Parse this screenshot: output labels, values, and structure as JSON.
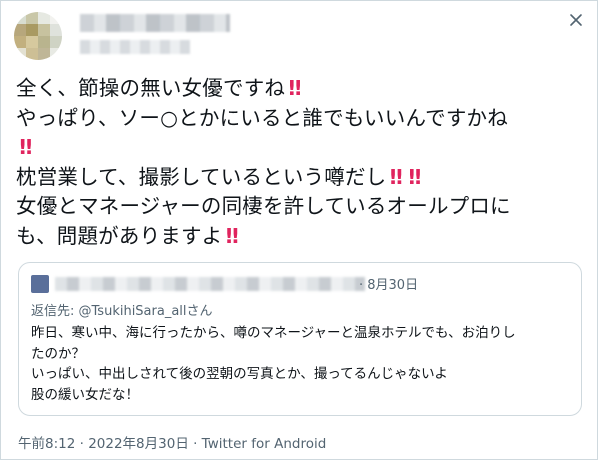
{
  "tweet": {
    "lines": [
      {
        "text": "全く、節操の無い女優ですね",
        "bangs": 1
      },
      {
        "text": "やっぱり、ソー○とかにいると誰でもいいんですかね",
        "bangs": 0
      },
      {
        "text": "",
        "bangs": 1
      },
      {
        "text": "枕営業して、撮影しているという噂だし",
        "bangs": 2
      },
      {
        "text": "女優とマネージャーの同棲を許しているオールプロに",
        "bangs": 0
      },
      {
        "text": "も、問題がありますよ",
        "bangs": 1
      }
    ],
    "bang_glyph": "!!",
    "bang_color": "#e0245e"
  },
  "icons": {
    "close": "close-icon",
    "avatar": "avatar-blurred",
    "quote_avatar": "avatar-blurred"
  },
  "quote": {
    "date": "· 8月30日",
    "reply_prefix": "返信先: ",
    "reply_handle": "@TsukihiSara_allさん",
    "lines": [
      "昨日、寒い中、海に行ったから、噂のマネージャーと温泉ホテルでも、お泊りし",
      "たのか？",
      "いっぱい、中出しされて後の翌朝の写真とか、撮ってるんじゃないよ",
      "股の緩い女だな！"
    ]
  },
  "footer": {
    "meta": "午前8:12 · 2022年8月30日 · Twitter for Android"
  }
}
